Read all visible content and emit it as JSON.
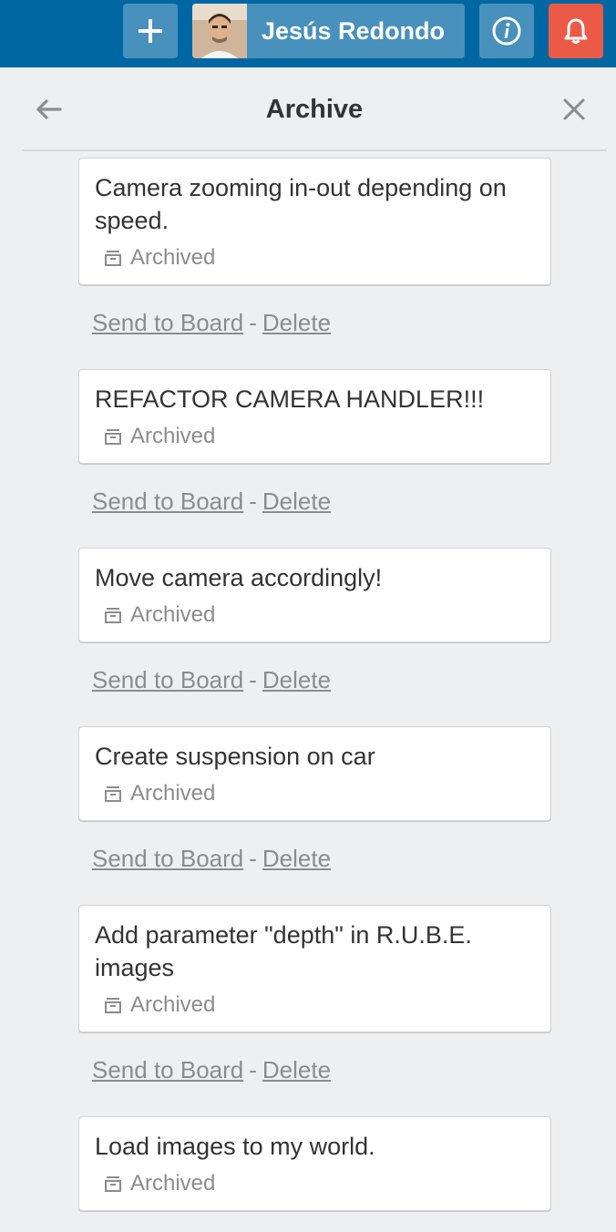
{
  "header": {
    "member_name": "Jesús Redondo",
    "add_icon": "plus-icon",
    "info_icon": "info-icon",
    "notification_icon": "bell-icon",
    "notification_color": "#eb5a46",
    "bar_color": "#0067a3"
  },
  "panel": {
    "title": "Archive",
    "back_icon": "arrow-left-icon",
    "close_icon": "close-icon"
  },
  "cards": [
    {
      "title": "Camera zooming in-out depending on speed.",
      "badge": "Archived",
      "send_label": "Send to Board",
      "separator": "-",
      "delete_label": "Delete"
    },
    {
      "title": "REFACTOR CAMERA HANDLER!!!",
      "badge": "Archived",
      "send_label": "Send to Board",
      "separator": "-",
      "delete_label": "Delete"
    },
    {
      "title": "Move camera accordingly!",
      "badge": "Archived",
      "send_label": "Send to Board",
      "separator": "-",
      "delete_label": "Delete"
    },
    {
      "title": "Create suspension on car",
      "badge": "Archived",
      "send_label": "Send to Board",
      "separator": "-",
      "delete_label": "Delete"
    },
    {
      "title": "Add parameter \"depth\" in R.U.B.E. images",
      "badge": "Archived",
      "send_label": "Send to Board",
      "separator": "-",
      "delete_label": "Delete"
    },
    {
      "title": "Load images to my world.",
      "badge": "Archived"
    }
  ]
}
